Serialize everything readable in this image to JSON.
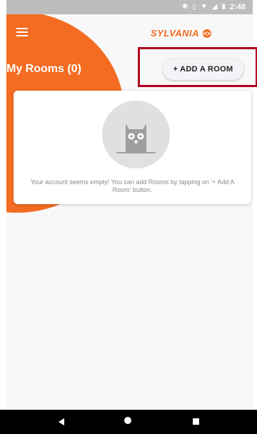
{
  "status_bar": {
    "time": "2:48",
    "icons": [
      "bluetooth-icon",
      "vibrate-icon",
      "wifi-icon",
      "signal-icon",
      "battery-icon"
    ]
  },
  "header": {
    "brand": "SYLVANIA",
    "brand_color": "#f36c21"
  },
  "rooms": {
    "title": "My Rooms (0)",
    "add_button_label": "+ ADD A ROOM"
  },
  "empty_state": {
    "message": "Your account seems empty! You can add Rooms by tapping on '+ Add A Room' button.",
    "illustration": "owl-icon"
  },
  "colors": {
    "accent": "#f36c21",
    "highlight": "#b0001e"
  }
}
